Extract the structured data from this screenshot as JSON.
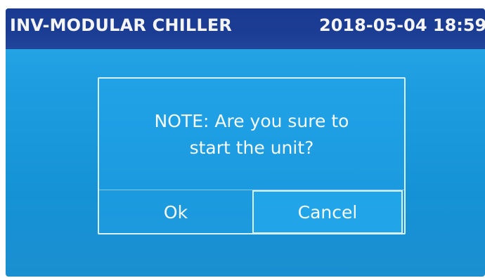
{
  "header": {
    "title": "INV-MODULAR CHILLER",
    "datetime": "2018-05-04 18:59"
  },
  "dialog": {
    "message_line1": "NOTE: Are you sure to",
    "message_line2": "start the unit?",
    "ok_label": "Ok",
    "cancel_label": "Cancel"
  },
  "colors": {
    "header_bg": "#1c3d94",
    "screen_bg": "#1d9de0",
    "dialog_border": "#d9f0ff",
    "text": "#f4f4f4"
  }
}
